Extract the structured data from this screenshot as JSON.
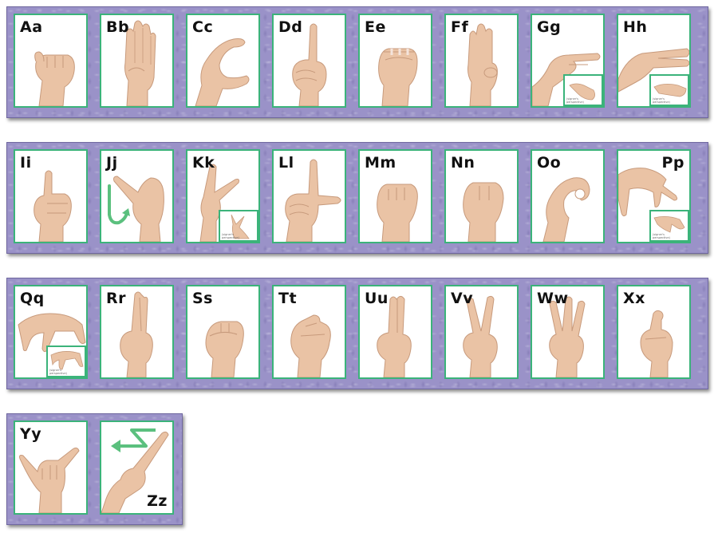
{
  "inset_caption": "(signer's perspective)",
  "colors": {
    "card_border": "#3bb37a",
    "strip": "#9a92c8",
    "skin": "#eac3a5",
    "arrow": "#5bc07e"
  },
  "rows": [
    [
      "Aa",
      "Bb",
      "Cc",
      "Dd",
      "Ee",
      "Ff",
      "Gg",
      "Hh"
    ],
    [
      "Ii",
      "Jj",
      "Kk",
      "Ll",
      "Mm",
      "Nn",
      "Oo",
      "Pp"
    ],
    [
      "Qq",
      "Rr",
      "Ss",
      "Tt",
      "Uu",
      "Vv",
      "Ww",
      "Xx"
    ],
    [
      "Yy",
      "Zz"
    ]
  ],
  "letters": {
    "a": "Aa",
    "b": "Bb",
    "c": "Cc",
    "d": "Dd",
    "e": "Ee",
    "f": "Ff",
    "g": "Gg",
    "h": "Hh",
    "i": "Ii",
    "j": "Jj",
    "k": "Kk",
    "l": "Ll",
    "m": "Mm",
    "n": "Nn",
    "o": "Oo",
    "p": "Pp",
    "q": "Qq",
    "r": "Rr",
    "s": "Ss",
    "t": "Tt",
    "u": "Uu",
    "v": "Vv",
    "w": "Ww",
    "x": "Xx",
    "y": "Yy",
    "z": "Zz"
  },
  "icons": {
    "hand": "hand-sign-icon",
    "inset": "signer-perspective-inset",
    "motion_j": "j-motion-arrow-icon",
    "motion_z": "z-motion-arrow-icon"
  }
}
